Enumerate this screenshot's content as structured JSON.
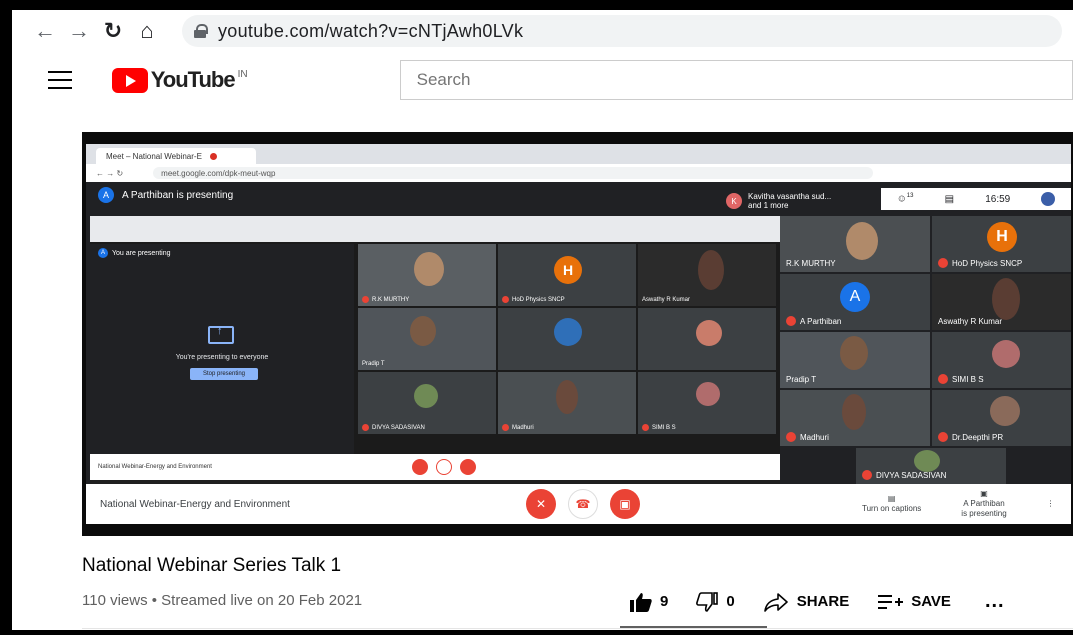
{
  "browser": {
    "url": "youtube.com/watch?v=cNTjAwh0LVk"
  },
  "youtube": {
    "logo_text": "YouTube",
    "country": "IN",
    "search_placeholder": "Search"
  },
  "video": {
    "meet": {
      "tab_title": "Meet – National Webinar-E",
      "address": "meet.google.com/dpk-meut-wqp",
      "presenter_banner": "A Parthiban is presenting",
      "presenter_initial": "A",
      "kavitha_label_line1": "Kavitha vasantha sud...",
      "kavitha_label_line2": "and 1 more",
      "kavitha_initial": "K",
      "participant_count": "13",
      "clock": "16:59",
      "shared_you_are_presenting": "You are presenting",
      "shared_presenting_everyone": "You're presenting to everyone",
      "shared_stop": "Stop presenting",
      "shared_clock": "4:59 PM",
      "tiles": {
        "rk_murthy": "R.K MURTHY",
        "hod_physics": "HoD Physics SNCP",
        "a_parthiban": "A Parthiban",
        "aswathy": "Aswathy R Kumar",
        "pradip": "Pradip T",
        "simi": "SIMI B S",
        "madhuri": "Madhuri",
        "deepthi": "Dr.Deepthi PR",
        "divya": "DIVYA SADASIVAN"
      },
      "h_initial": "H",
      "a_initial": "A",
      "meeting_name": "National Webinar-Energy and Environment",
      "captions_label": "Turn on captions",
      "presenting_label_1": "A Parthiban",
      "presenting_label_2": "is presenting"
    }
  },
  "details": {
    "title": "National Webinar Series Talk 1",
    "meta": "110 views • Streamed live on 20 Feb 2021",
    "likes": "9",
    "dislikes": "0",
    "share": "SHARE",
    "save": "SAVE",
    "more": "..."
  }
}
